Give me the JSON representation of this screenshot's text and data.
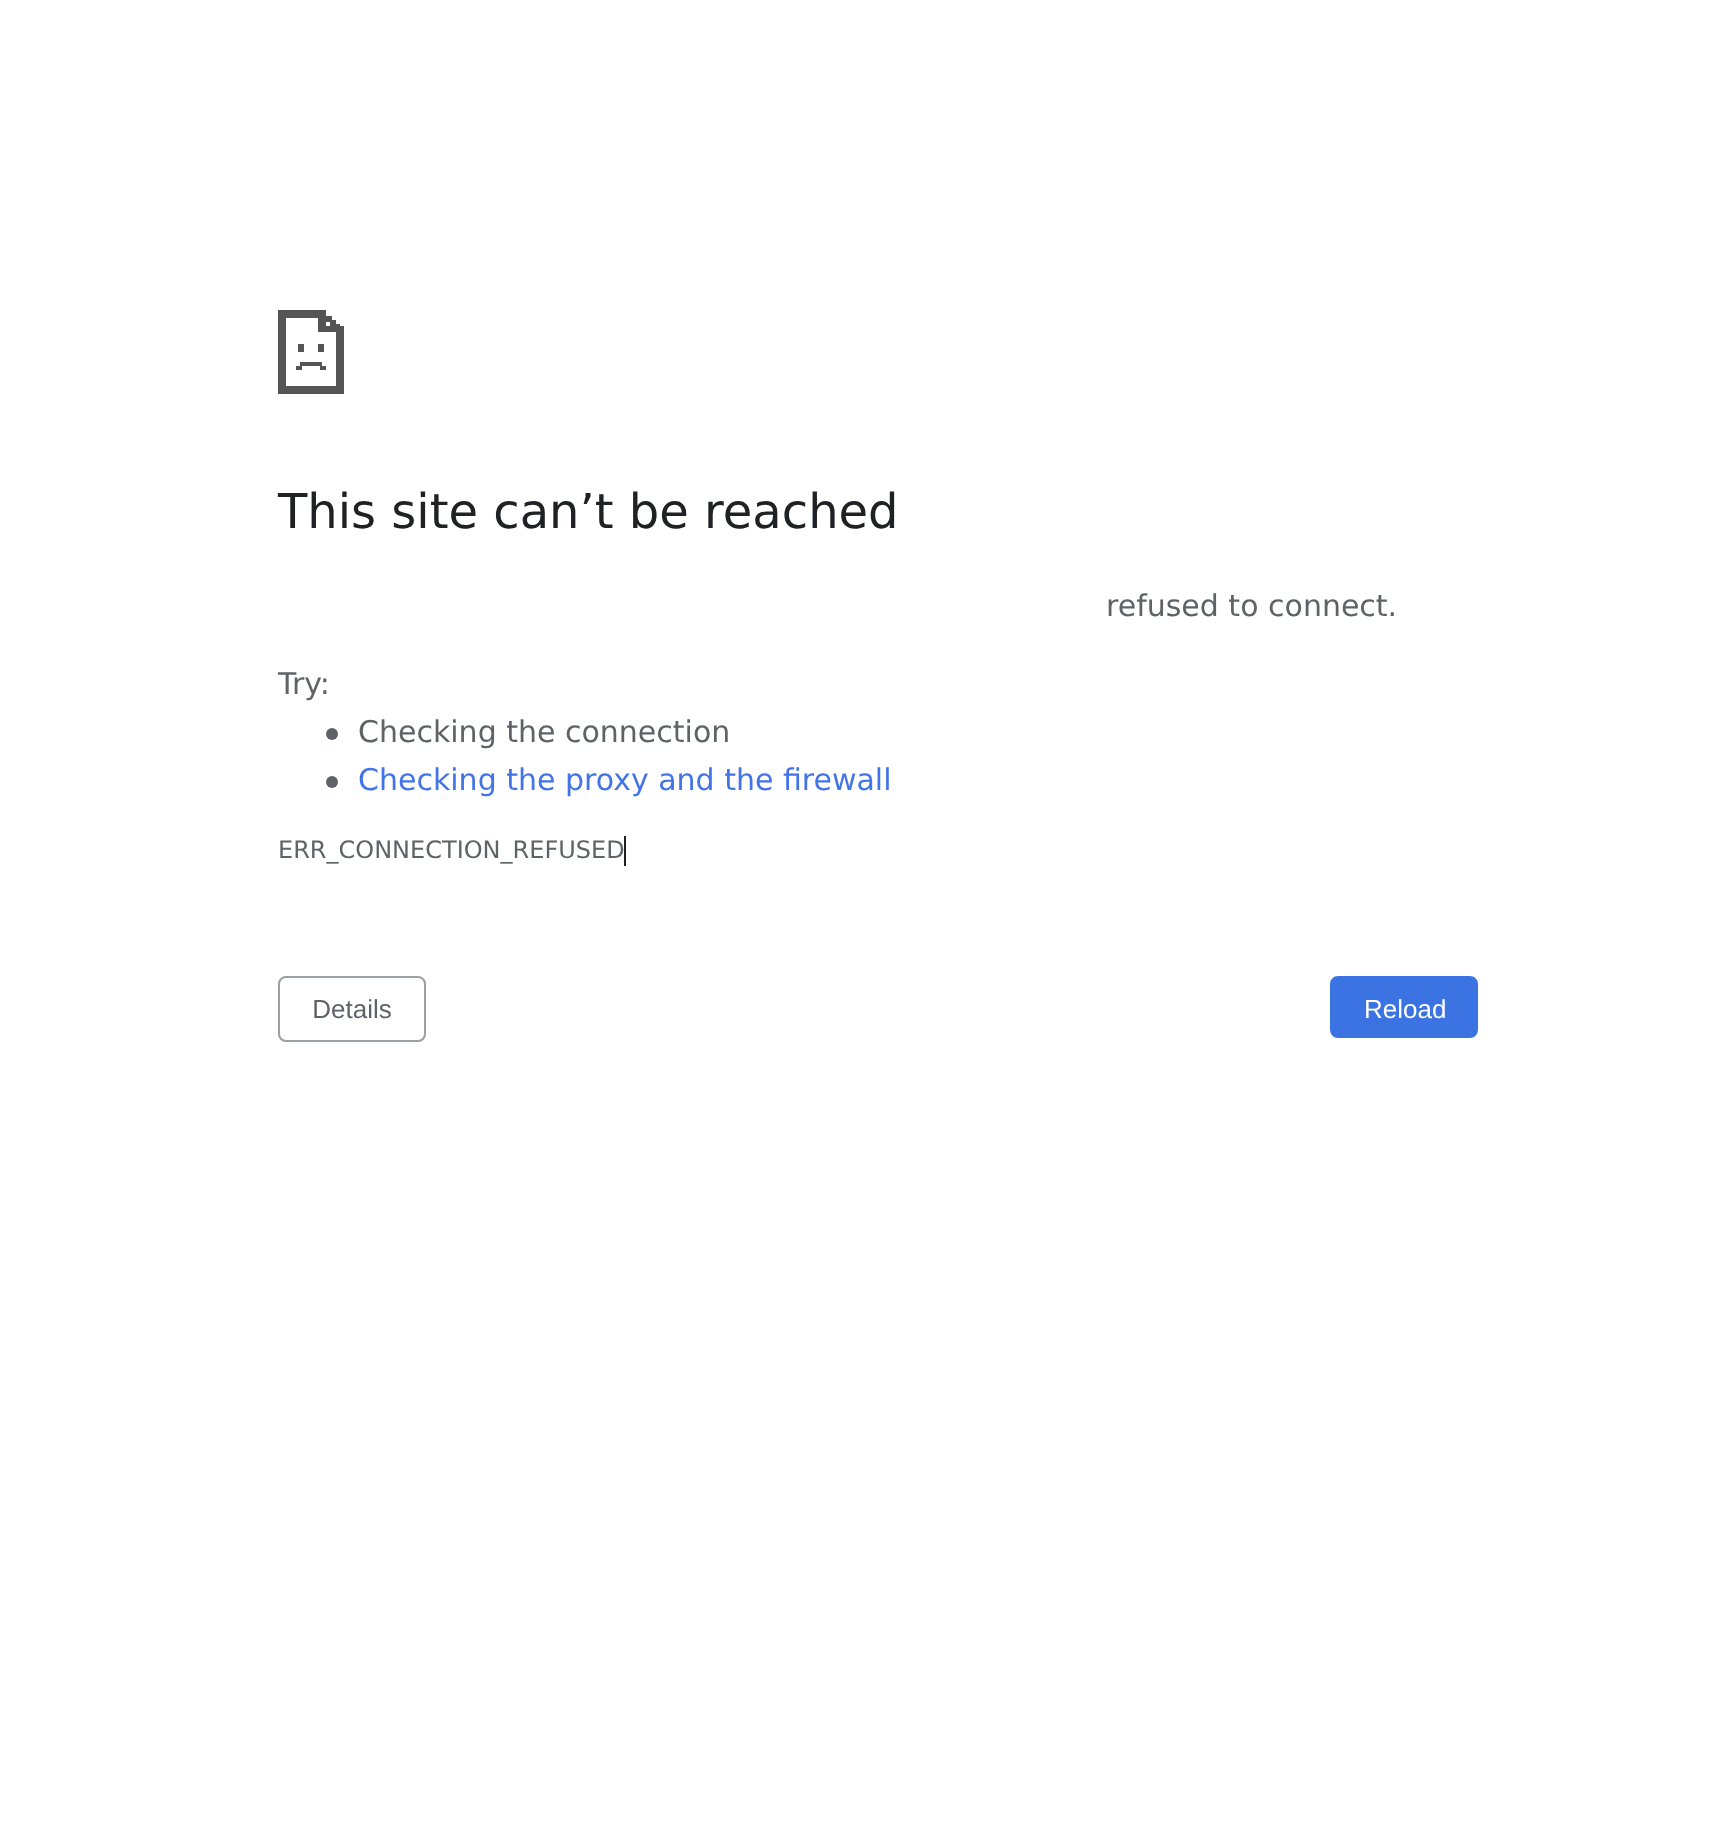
{
  "heading": "This site can’t be reached",
  "message": "refused to connect.",
  "suggestions": {
    "label": "Try:",
    "items": [
      {
        "kind": "text",
        "text": "Checking the connection"
      },
      {
        "kind": "link",
        "text": "Checking the proxy and the firewall"
      }
    ]
  },
  "error_code": "ERR_CONNECTION_REFUSED",
  "buttons": [
    {
      "kind": "secondary",
      "label": "Details"
    },
    {
      "kind": "primary",
      "label": "Reload"
    }
  ]
}
